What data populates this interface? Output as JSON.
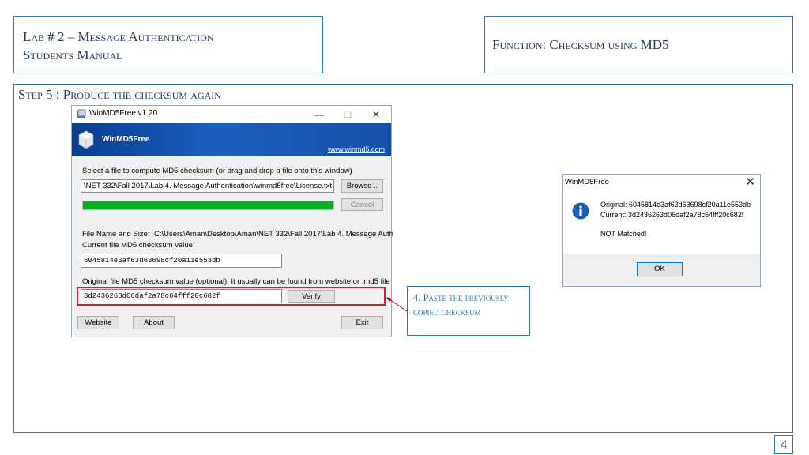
{
  "header_left": {
    "line1": "Lab # 2 – Message Authentication",
    "line2": "Students Manual"
  },
  "header_right": {
    "title": "Function: Checksum using MD5"
  },
  "step": {
    "title": "Step 5 : Produce the checksum again"
  },
  "winmd5": {
    "window_title": "WinMD5Free v1.20",
    "controls": {
      "minimize": "—",
      "maximize": "☐",
      "close": "✕"
    },
    "banner": {
      "name": "WinMD5Free",
      "url": "www.winmd5.com"
    },
    "select_label": "Select a file to compute MD5 checksum (or drag and drop a file onto this window)",
    "file_path": "\\NET 332\\Fall 2017\\Lab 4. Message Authentication\\winmd5free\\License.txt",
    "browse_label": "Browse ..",
    "cancel_label": "Cancel",
    "progress_percent": 100,
    "filename_label": "File Name and Size:",
    "filename_value": "C:\\Users\\Aman\\Desktop\\Aman\\NET 332\\Fall 2017\\Lab 4. Message Auth",
    "current_label": "Current file MD5 checksum value:",
    "current_value": "6045814e3af63d63698cf20a11e553db",
    "original_label": "Original file MD5 checksum value (optional). It usually can be found from website or .md5 file",
    "original_value": "3d2436263d06daf2a78c64fff20c682f",
    "verify_label": "Verify",
    "website_label": "Website",
    "about_label": "About",
    "exit_label": "Exit"
  },
  "callout": {
    "text": "4. Paste the previously copied checksum"
  },
  "dialog": {
    "title": "WinMD5Free",
    "close": "✕",
    "original_line": "Original: 6045814e3af63d63698cf20a11e553db",
    "current_line": "Current: 3d2436263d06daf2a78c64fff20c682f",
    "result": "NOT Matched!",
    "ok_label": "OK"
  },
  "page_number": "4",
  "colors": {
    "frame": "#2e75b6",
    "heading": "#1f3864",
    "highlight": "#e01b24",
    "progress": "#06b025",
    "banner": "#0a3d8f"
  }
}
